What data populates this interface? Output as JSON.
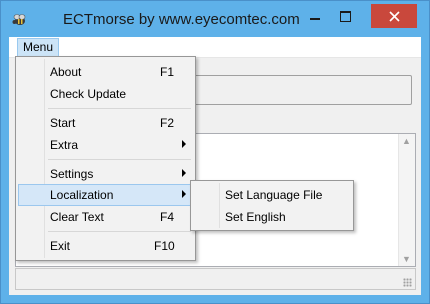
{
  "window": {
    "title": "ECTmorse by www.eyecomtec.com",
    "titlebar_color": "#5eb1e9",
    "close_color": "#c9483c",
    "app_icon": "bee-icon"
  },
  "menubar": {
    "menu_label": "Menu"
  },
  "menu": {
    "items": [
      {
        "label": "About",
        "shortcut": "F1"
      },
      {
        "label": "Check Update",
        "shortcut": ""
      },
      {
        "label": "Start",
        "shortcut": "F2"
      },
      {
        "label": "Extra",
        "shortcut": "",
        "submenu": true
      },
      {
        "label": "Settings",
        "shortcut": "",
        "submenu": true
      },
      {
        "label": "Localization",
        "shortcut": "",
        "submenu": true,
        "highlighted": true
      },
      {
        "label": "Clear Text",
        "shortcut": "F4"
      },
      {
        "label": "Exit",
        "shortcut": "F10"
      }
    ]
  },
  "localization_submenu": {
    "items": [
      {
        "label": "Set Language File"
      },
      {
        "label": "Set English"
      }
    ]
  },
  "colors": {
    "highlight": "#d5e7f8",
    "highlight_border": "#9bc7ee"
  }
}
